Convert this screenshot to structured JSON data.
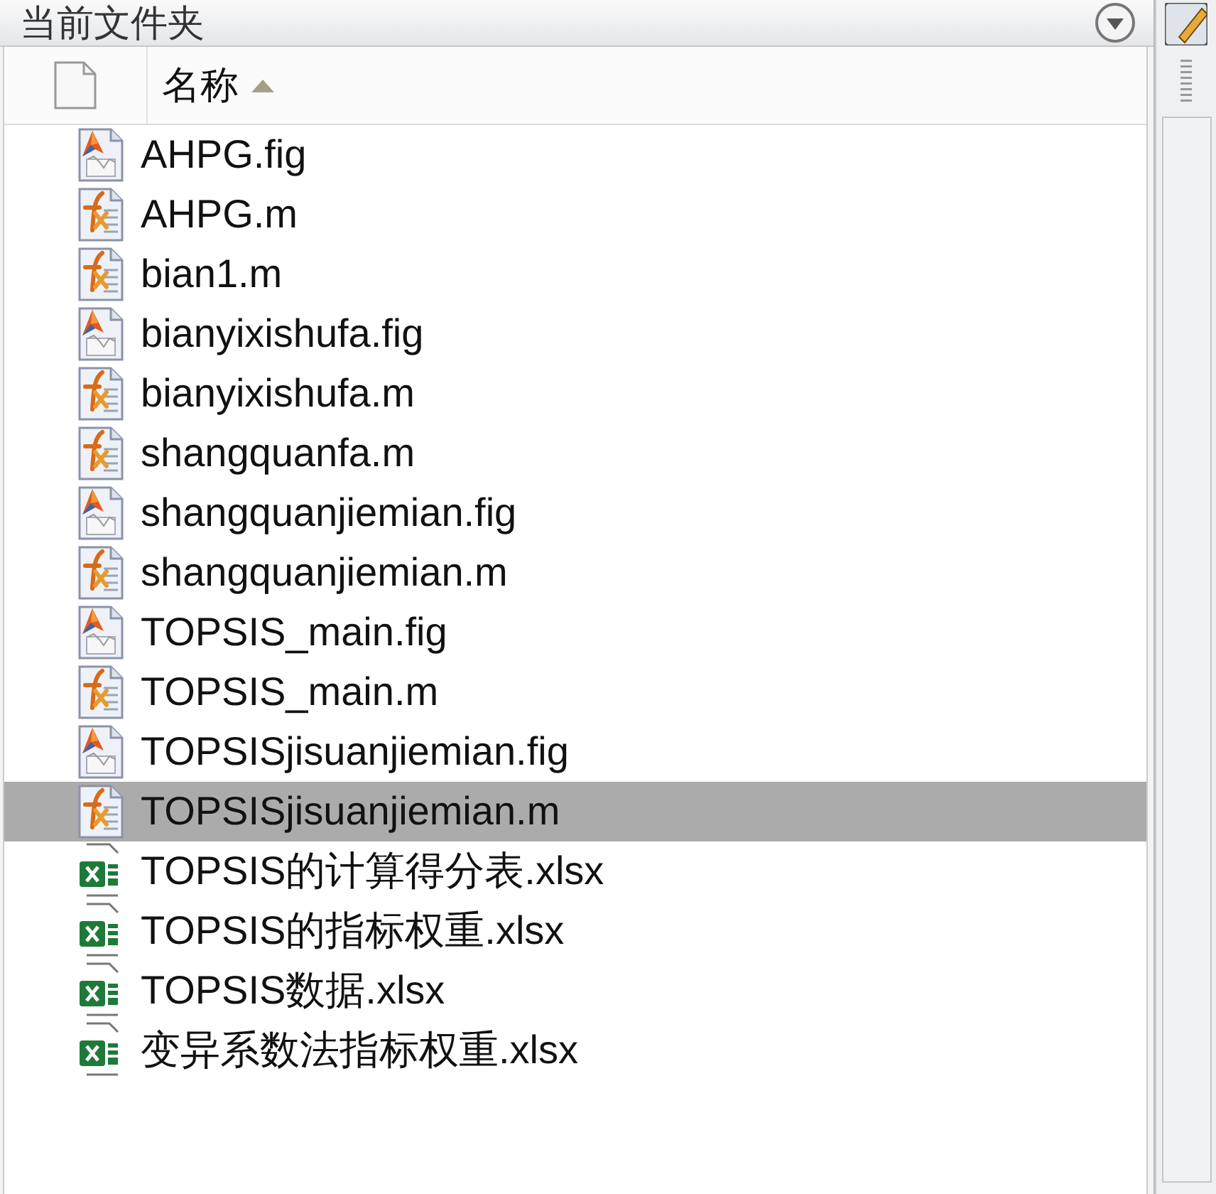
{
  "panel": {
    "title": "当前文件夹"
  },
  "header": {
    "name_column": "名称"
  },
  "files": [
    {
      "name": "AHPG.fig",
      "kind": "fig",
      "selected": false
    },
    {
      "name": "AHPG.m",
      "kind": "m",
      "selected": false
    },
    {
      "name": "bian1.m",
      "kind": "m",
      "selected": false
    },
    {
      "name": "bianyixishufa.fig",
      "kind": "fig",
      "selected": false
    },
    {
      "name": "bianyixishufa.m",
      "kind": "m",
      "selected": false
    },
    {
      "name": "shangquanfa.m",
      "kind": "m",
      "selected": false
    },
    {
      "name": "shangquanjiemian.fig",
      "kind": "fig",
      "selected": false
    },
    {
      "name": "shangquanjiemian.m",
      "kind": "m",
      "selected": false
    },
    {
      "name": "TOPSIS_main.fig",
      "kind": "fig",
      "selected": false
    },
    {
      "name": "TOPSIS_main.m",
      "kind": "m",
      "selected": false
    },
    {
      "name": "TOPSISjisuanjiemian.fig",
      "kind": "fig",
      "selected": false
    },
    {
      "name": "TOPSISjisuanjiemian.m",
      "kind": "m",
      "selected": true
    },
    {
      "name": "TOPSIS的计算得分表.xlsx",
      "kind": "xlsx",
      "selected": false
    },
    {
      "name": "TOPSIS的指标权重.xlsx",
      "kind": "xlsx",
      "selected": false
    },
    {
      "name": "TOPSIS数据.xlsx",
      "kind": "xlsx",
      "selected": false
    },
    {
      "name": "变异系数法指标权重.xlsx",
      "kind": "xlsx",
      "selected": false
    }
  ]
}
